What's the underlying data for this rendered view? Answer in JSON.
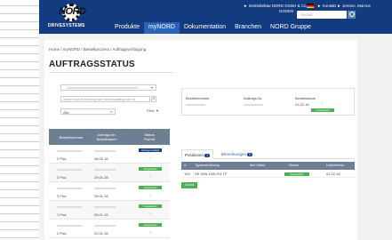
{
  "header": {
    "logo_text": "NORD",
    "logo_subtext": "DRIVESYSTEMS",
    "company_line1": "Getriebebau NORD GmbH & Co. KG",
    "company_line2": "GOSEN",
    "contact_line1": "Kontakt",
    "contact_line2": "Jensen, Marcus",
    "search_placeholder": "SUCHE",
    "nav": [
      "Produkte",
      "myNORD",
      "Dokumentation",
      "Branchen",
      "NORD Gruppe"
    ]
  },
  "breadcrumb": "Home  /  myNORD  /  Bestellprozess  /  Auftragsverfolgung",
  "page_title": "AUFTRAGSSTATUS",
  "filters": {
    "search_placeholder": "Suche nach Bestellung oder Kundenauftrag von Nr.",
    "status_select": "Alle",
    "filter_link": "Filter"
  },
  "orders_table": {
    "headers": [
      "Bestellnummer",
      "Auftrags-Nr. Bestelldatum",
      "Status Favorit"
    ],
    "rows": [
      {
        "pos": "2 Pos.",
        "date": "08.02.16",
        "status": "Auftrag bestätigt",
        "status_color": "#123b80"
      },
      {
        "pos": "3 Pos.",
        "date": "29.01.16",
        "status": "Ausgeliefert",
        "status_color": "#4caf50"
      },
      {
        "pos": "3 Pos.",
        "date": "29.01.16",
        "status": "Ausgeliefert",
        "status_color": "#4caf50"
      },
      {
        "pos": "1 Pos.",
        "date": "29.01.16",
        "status": "Ausgeliefert",
        "status_color": "#4caf50"
      },
      {
        "pos": "2 Pos.",
        "date": "22.01.16",
        "status": "Ausgeliefert",
        "status_color": "#4caf50"
      }
    ]
  },
  "detail": {
    "label_order": "Bestellnummer",
    "label_auftrag": "Auftrags-Nr.",
    "label_date": "Bestelldatum",
    "date": "21.01.16",
    "status": "Ausgeliefert"
  },
  "tabs": [
    {
      "label": "Positionen",
      "count": "1"
    },
    {
      "label": "Bemerkungen",
      "count": "0"
    }
  ],
  "positions_table": {
    "headers": [
      "#",
      "Typbezeichnung",
      "Ihre Matnr",
      "Status",
      "Liefertermin"
    ],
    "rows": [
      {
        "num": "100",
        "type": "SK 9/05-100LP/4 TF",
        "status": "Ausgeliefert",
        "date": "01.02.16"
      }
    ]
  },
  "return_button": "Zurück",
  "colors": {
    "brand": "#123b80",
    "nav_active": "#2b63b6",
    "success": "#4caf50",
    "table_head": "#6f7f93"
  }
}
